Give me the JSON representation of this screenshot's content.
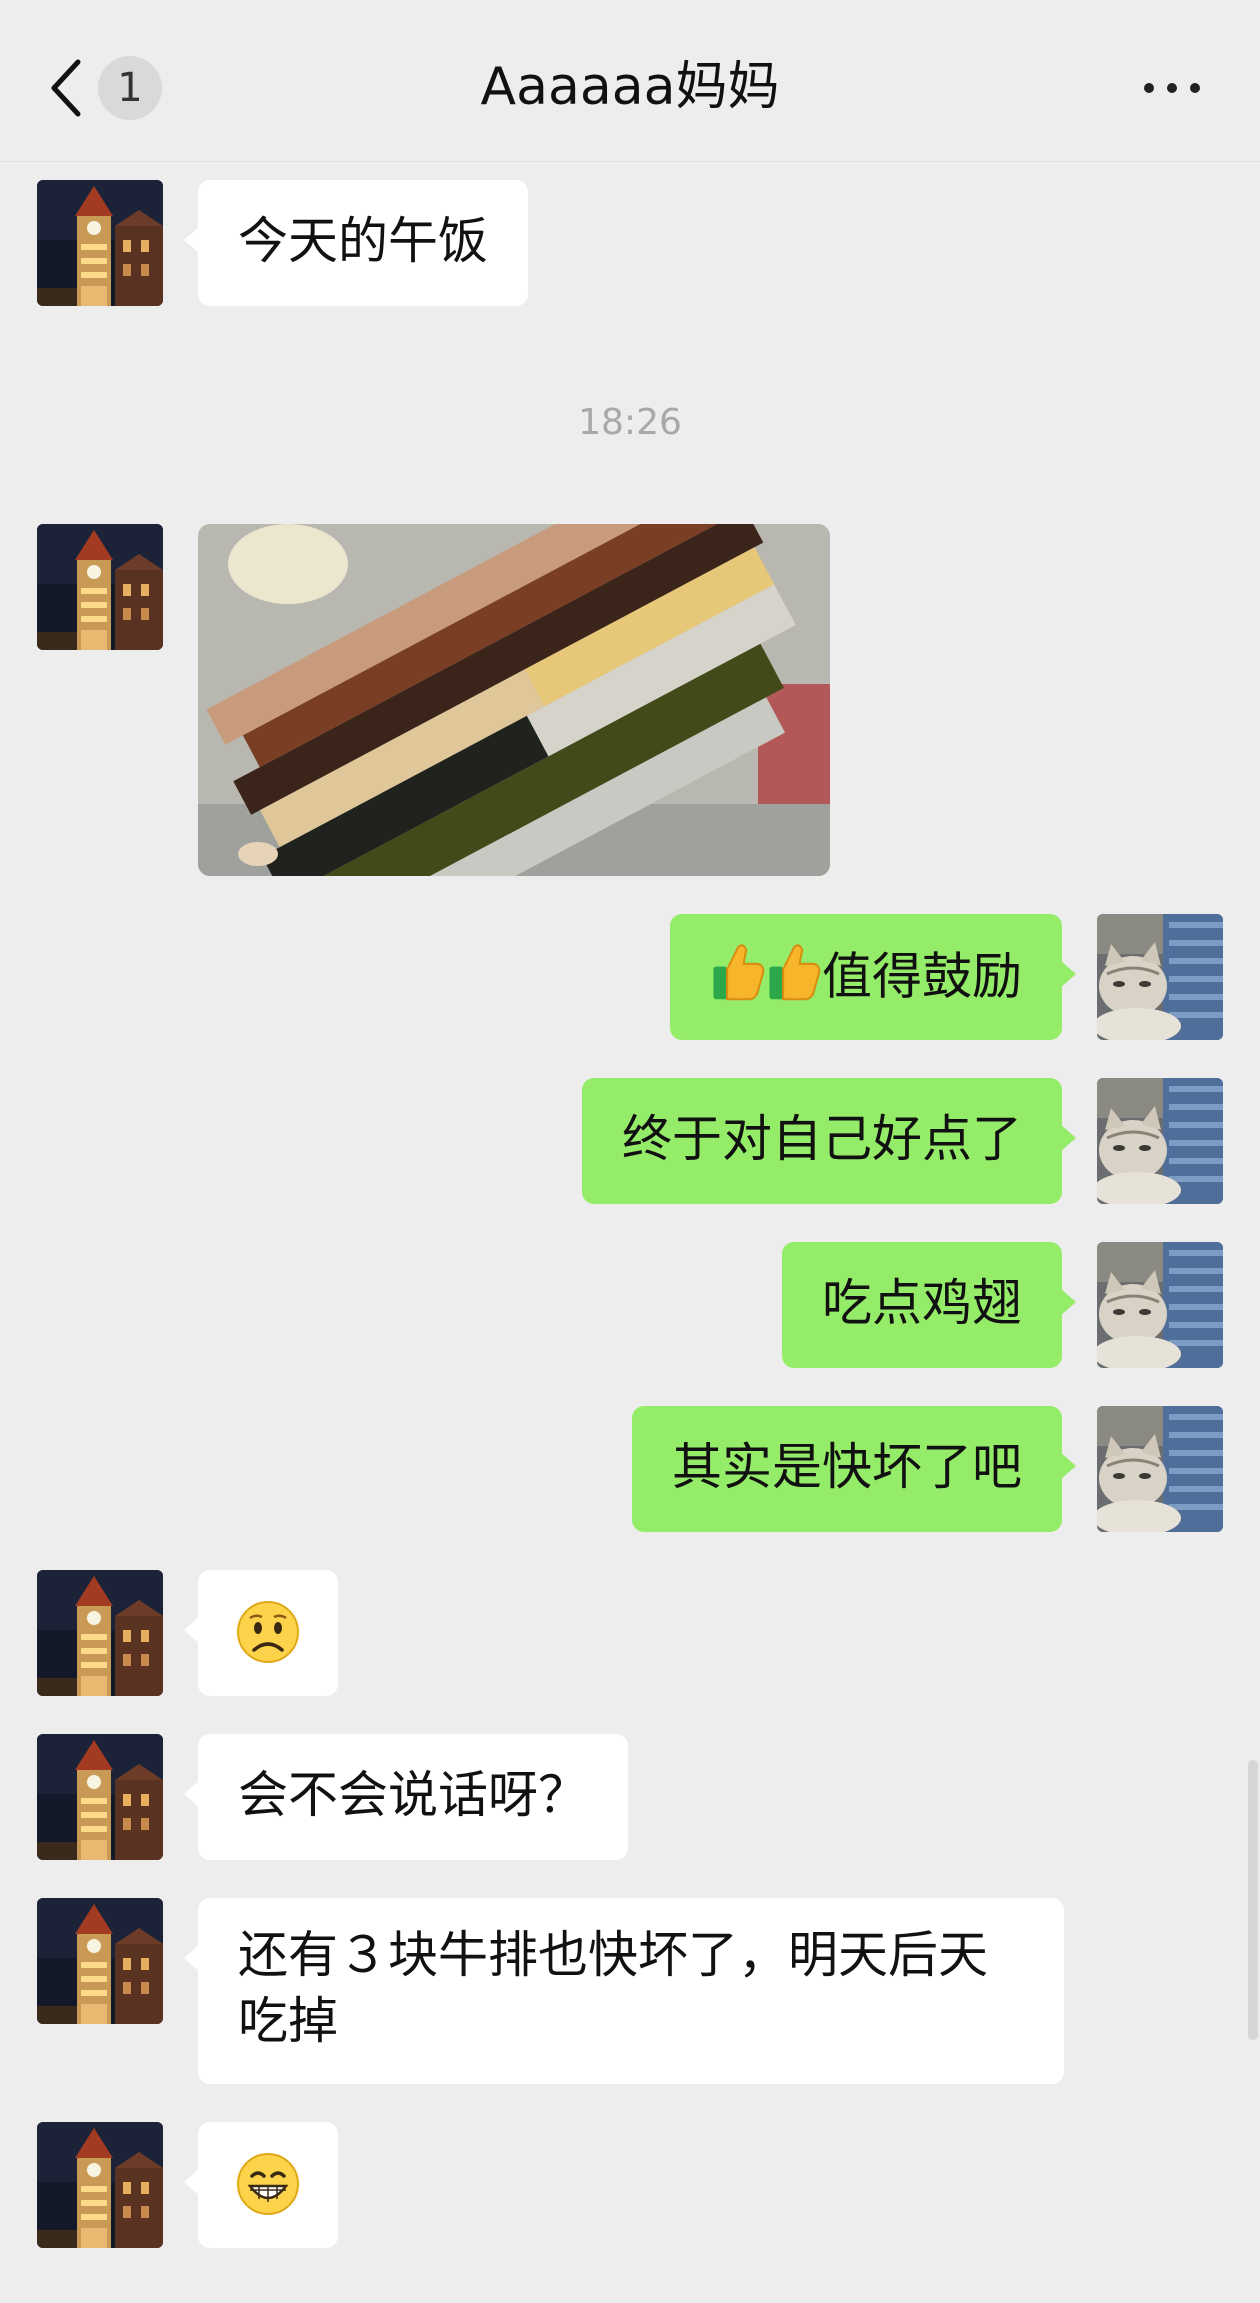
{
  "header": {
    "title": "Aaaaaa妈妈",
    "unread_count": "1",
    "back_icon": "chevron-left-icon",
    "more_icon": "more-dots-icon"
  },
  "messages": [
    {
      "side": "in",
      "type": "text",
      "text": "今天的午饭"
    },
    {
      "type": "time",
      "text": "18:26"
    },
    {
      "side": "in",
      "type": "image",
      "content": "blurred-food-photo"
    },
    {
      "side": "out",
      "type": "text",
      "text": "值得鼓励",
      "prefix_icons": [
        "thumbs-up-icon",
        "thumbs-up-icon"
      ]
    },
    {
      "side": "out",
      "type": "text",
      "text": "终于对自己好点了"
    },
    {
      "side": "out",
      "type": "text",
      "text": "吃点鸡翅"
    },
    {
      "side": "out",
      "type": "text",
      "text": "其实是快坏了吧"
    },
    {
      "side": "in",
      "type": "emoji",
      "icon": "frown-emoji-icon"
    },
    {
      "side": "in",
      "type": "text",
      "text": "会不会说话呀？"
    },
    {
      "side": "in",
      "type": "text",
      "text": "还有３块牛排也快坏了，明天后天吃掉"
    },
    {
      "side": "in",
      "type": "emoji",
      "icon": "grin-emoji-icon"
    }
  ],
  "colors": {
    "background": "#ededed",
    "outgoing_bubble": "#95ec69",
    "incoming_bubble": "#ffffff"
  }
}
